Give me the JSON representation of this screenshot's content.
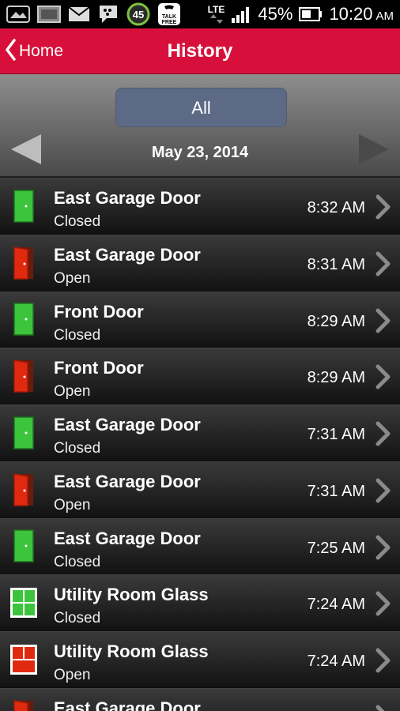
{
  "status_bar": {
    "icons": [
      "image-icon",
      "gallery-icon",
      "mail-icon",
      "bbm-icon",
      "counter-badge-icon",
      "talk-free-icon"
    ],
    "counter_badge": "45",
    "talk_free": "TALK FREE",
    "network": "LTE",
    "battery": "45%",
    "time": "10:20",
    "ampm": "AM"
  },
  "header": {
    "back_label": "Home",
    "title": "History",
    "color": "#d6103a"
  },
  "filter": {
    "all_label": "All",
    "date": "May 23, 2014"
  },
  "events": [
    {
      "name": "East Garage Door",
      "state": "Closed",
      "time": "8:32 AM",
      "icon": "door-closed-icon"
    },
    {
      "name": "East Garage Door",
      "state": "Open",
      "time": "8:31 AM",
      "icon": "door-open-icon"
    },
    {
      "name": "Front Door",
      "state": "Closed",
      "time": "8:29 AM",
      "icon": "door-closed-icon"
    },
    {
      "name": "Front Door",
      "state": "Open",
      "time": "8:29 AM",
      "icon": "door-open-icon"
    },
    {
      "name": "East Garage Door",
      "state": "Closed",
      "time": "7:31 AM",
      "icon": "door-closed-icon"
    },
    {
      "name": "East Garage Door",
      "state": "Open",
      "time": "7:31 AM",
      "icon": "door-open-icon"
    },
    {
      "name": "East Garage Door",
      "state": "Closed",
      "time": "7:25 AM",
      "icon": "door-closed-icon"
    },
    {
      "name": "Utility Room Glass",
      "state": "Closed",
      "time": "7:24 AM",
      "icon": "window-closed-icon"
    },
    {
      "name": "Utility Room Glass",
      "state": "Open",
      "time": "7:24 AM",
      "icon": "window-open-icon"
    },
    {
      "name": "East Garage Door",
      "state": "",
      "time": "",
      "icon": "door-open-icon"
    }
  ],
  "colors": {
    "closed": "#3cc43c",
    "open": "#e02a10"
  }
}
